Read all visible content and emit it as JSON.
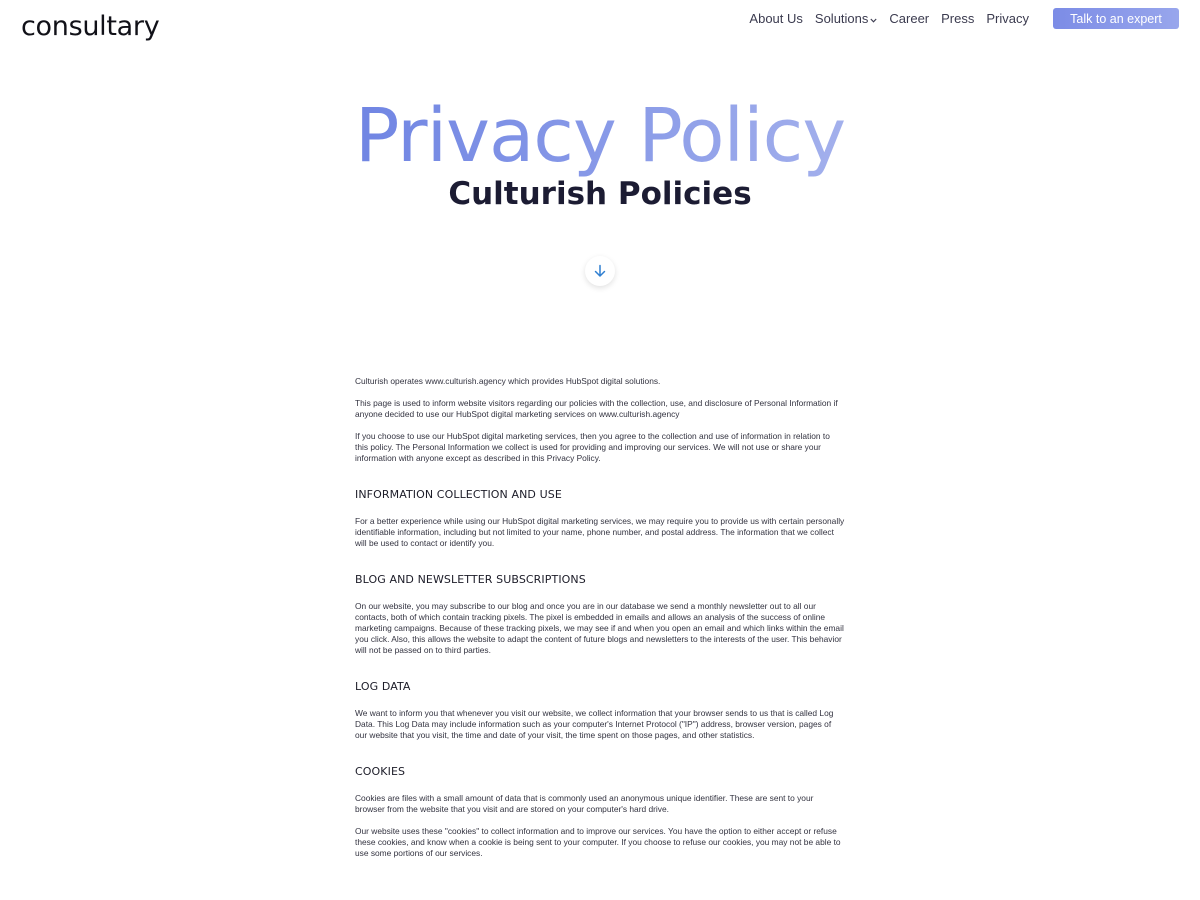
{
  "header": {
    "logo": "consultary",
    "nav": {
      "about": "About Us",
      "solutions": "Solutions",
      "career": "Career",
      "press": "Press",
      "privacy": "Privacy"
    },
    "cta_label": "Talk to an expert"
  },
  "hero": {
    "title": "Privacy Policy",
    "subtitle": "Culturish Policies"
  },
  "content": {
    "intro": [
      "Culturish operates www.culturish.agency which provides HubSpot digital solutions.",
      "This page is used to inform website visitors regarding our policies with the collection, use, and disclosure of Personal Information if anyone decided to use our HubSpot digital marketing services on www.culturish.agency",
      "If you choose to use our HubSpot digital marketing services, then you agree to the collection and use of information in relation to this policy. The Personal Information we collect is used for providing and improving our services. We will not use or share your information with anyone except as described in this Privacy Policy."
    ],
    "sections": [
      {
        "heading": "INFORMATION COLLECTION AND USE",
        "paragraphs": [
          "For a better experience while using our HubSpot digital marketing services, we may require you to provide us with certain personally identifiable information, including but not limited to your name, phone number, and postal address. The information that we collect will be used to contact or identify you."
        ]
      },
      {
        "heading": "BLOG AND NEWSLETTER SUBSCRIPTIONS",
        "paragraphs": [
          "On our website, you may subscribe to our blog and once you are in our database we send a monthly newsletter out to all our contacts, both of which contain tracking pixels. The pixel is embedded in emails and allows an analysis of the success of online marketing campaigns. Because of these tracking pixels, we may see if and when you open an email and which links within the email you click. Also, this allows the website to adapt the content of future blogs and newsletters to the interests of the user. This behavior will not be passed on to third parties."
        ]
      },
      {
        "heading": "LOG DATA",
        "paragraphs": [
          "We want to inform you that whenever you visit our website, we collect information that your browser sends to us that is called Log Data. This Log Data may include information such as your computer's Internet Protocol (\"IP\") address, browser version, pages of our website that you visit, the time and date of your visit, the time spent on those pages, and other statistics."
        ]
      },
      {
        "heading": "COOKIES",
        "paragraphs": [
          "Cookies are files with a small amount of data that is commonly used an anonymous unique identifier. These are sent to your browser from the website that you visit and are stored on your computer's hard drive.",
          "Our website uses these \"cookies\" to collect information and to improve our services. You have the option to either accept or refuse these cookies, and know when a cookie is being sent to your computer. If you choose to refuse our cookies, you may not be able to use some portions of our services."
        ]
      }
    ]
  },
  "icons": {
    "solutions_dropdown": "chevron-down-icon",
    "scroll_down": "arrow-down-icon"
  },
  "colors": {
    "accent": "#7c8ce6",
    "title_gradient_start": "#7085e3",
    "title_gradient_end": "#a3b0ec",
    "heading_dark": "#1c1c33",
    "scroll_arrow": "#2f7fd1"
  }
}
